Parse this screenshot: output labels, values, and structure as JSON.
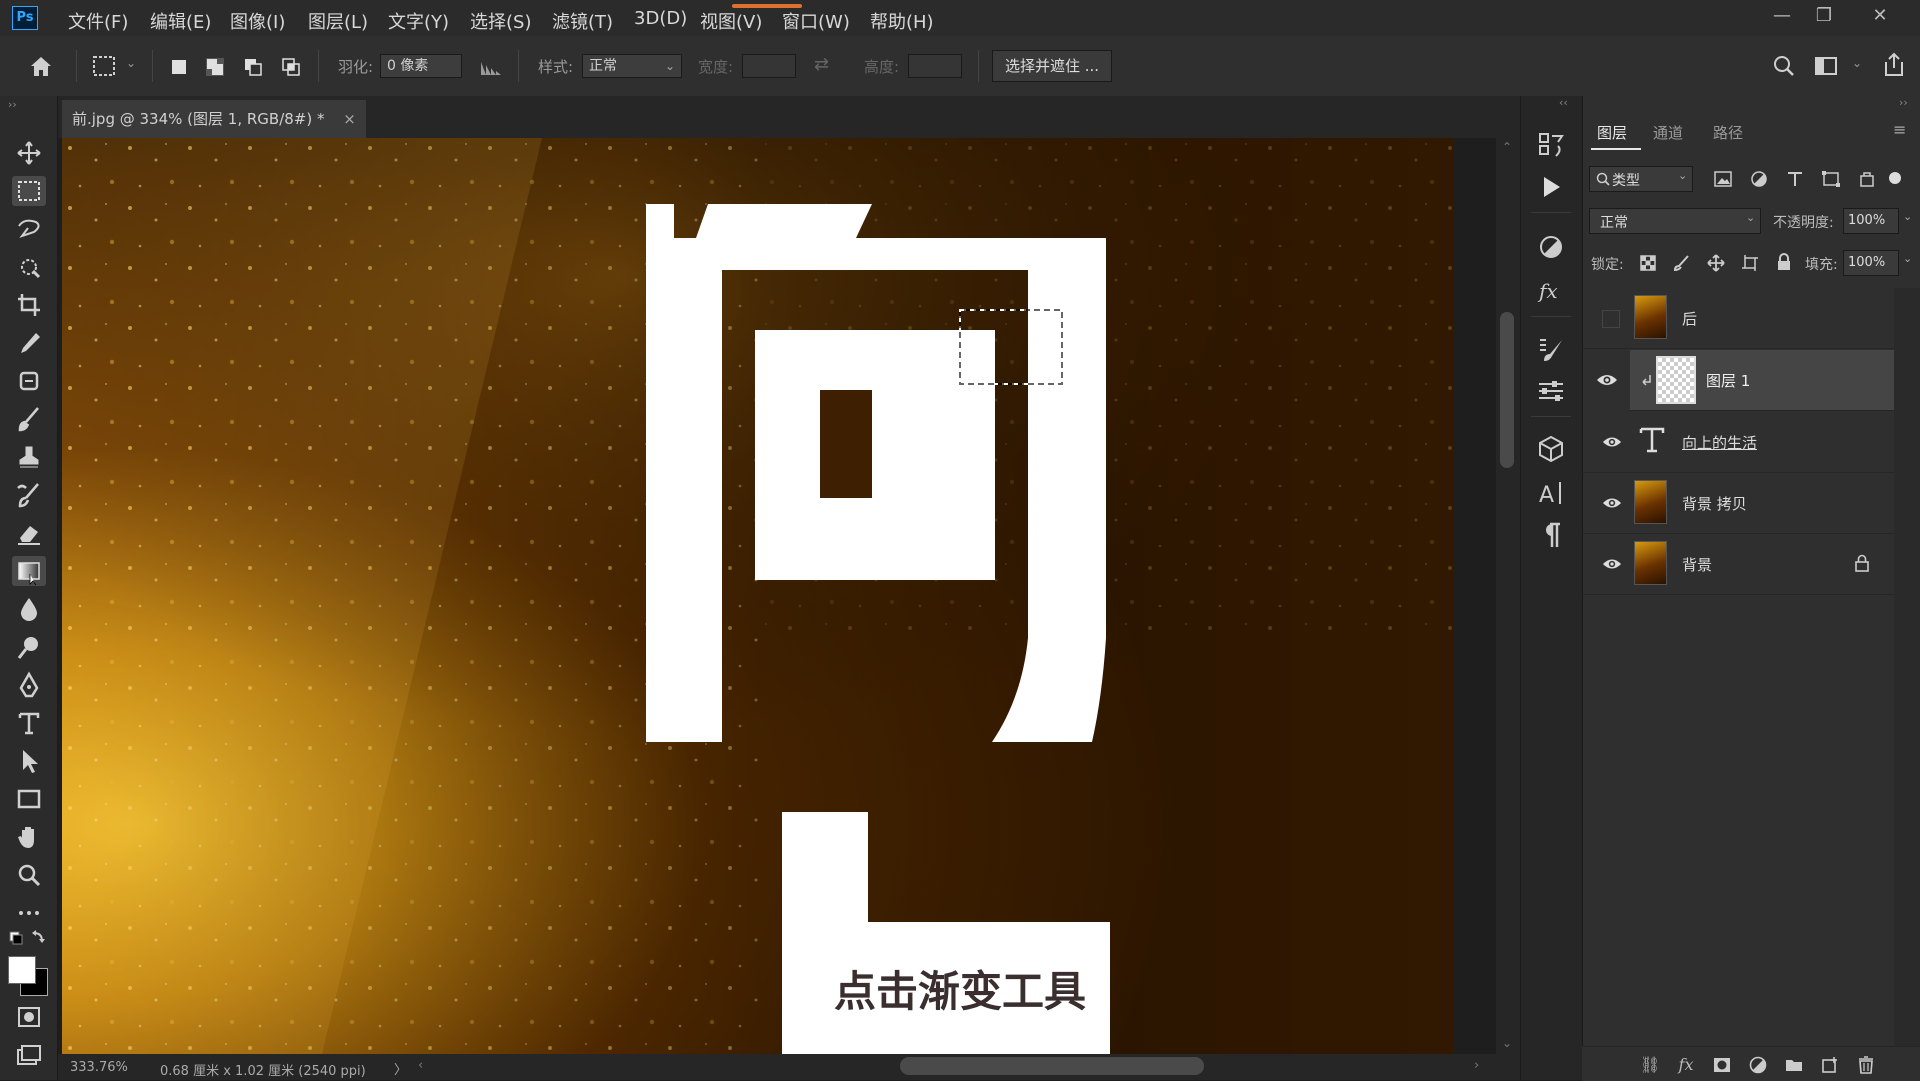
{
  "app": {
    "logo": "Ps"
  },
  "menu": [
    "文件(F)",
    "编辑(E)",
    "图像(I)",
    "图层(L)",
    "文字(Y)",
    "选择(S)",
    "滤镜(T)",
    "3D(D)",
    "视图(V)",
    "窗口(W)",
    "帮助(H)"
  ],
  "options": {
    "feather_label": "羽化:",
    "feather_value": "0 像素",
    "style_label": "样式:",
    "style_value": "正常",
    "width_label": "宽度:",
    "height_label": "高度:",
    "select_mask_button": "选择并遮住 ..."
  },
  "document": {
    "tab_title": "前.jpg @ 334% (图层 1, RGB/8#) *",
    "close_symbol": "×"
  },
  "status": {
    "zoom": "333.76%",
    "doc_size": "0.68 厘米 x 1.02 厘米 (2540 ppi)",
    "arrow": "〉"
  },
  "layers_panel": {
    "tabs": [
      "图层",
      "通道",
      "路径"
    ],
    "filter_kind": "类型",
    "blend_mode": "正常",
    "opacity_label": "不透明度:",
    "opacity_value": "100%",
    "lock_label": "锁定:",
    "fill_label": "填充:",
    "fill_value": "100%",
    "layers": [
      {
        "name": "后",
        "visible": false,
        "selected": false,
        "type": "image"
      },
      {
        "name": "图层 1",
        "visible": true,
        "selected": true,
        "type": "transparent"
      },
      {
        "name": "向上的生活",
        "visible": true,
        "selected": false,
        "type": "text"
      },
      {
        "name": "背景 拷贝",
        "visible": true,
        "selected": false,
        "type": "image"
      },
      {
        "name": "背景",
        "visible": true,
        "selected": false,
        "type": "image",
        "locked": true
      }
    ]
  },
  "subtitle": "点击渐变工具",
  "colors": {
    "accent": "#31a8ff",
    "foreground_swatch": "#ffffff",
    "background_swatch": "#000000",
    "canvas_dark": "#3a1d00",
    "canvas_gold": "#d89a10"
  }
}
